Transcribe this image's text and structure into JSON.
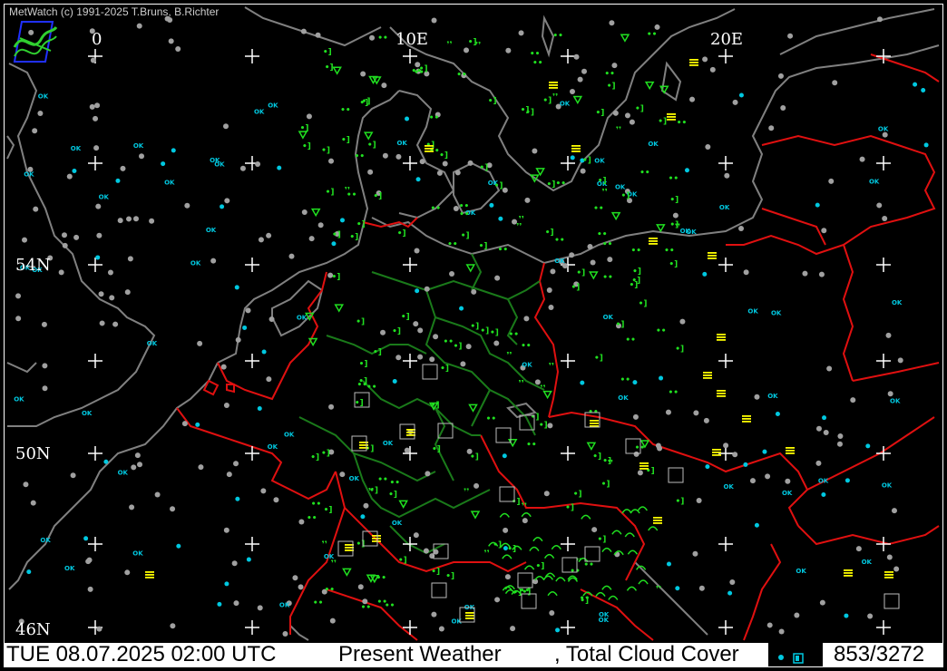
{
  "credit": "MetWatch  (c) 1991-2025 T.Bruns, B.Richter",
  "grid_labels": {
    "lon_0": "0",
    "lon_10": "10E",
    "lon_20": "20E",
    "lat_54": "54N",
    "lat_50": "50N",
    "lat_46": "46N"
  },
  "status": {
    "datetime": "TUE 08.07.2025 02:00 UTC",
    "product": "Present Weather",
    "product2": ", Total Cloud Cover",
    "count": "853/3272"
  },
  "colors": {
    "background": "#000000",
    "coastline": "#808080",
    "border_country": "#e01010",
    "border_state": "#1a7a1a",
    "cloud_clear": "#00c8e0",
    "station": "#a0a0a0",
    "rain": "#20e020",
    "fog": "#ffff00",
    "grid": "#ffffff"
  },
  "icons": [
    "logo-icon",
    "station-dot-icon",
    "rain-symbol-icon",
    "fog-symbol-icon",
    "shower-symbol-icon",
    "thunder-symbol-icon",
    "grid-cross-icon"
  ]
}
